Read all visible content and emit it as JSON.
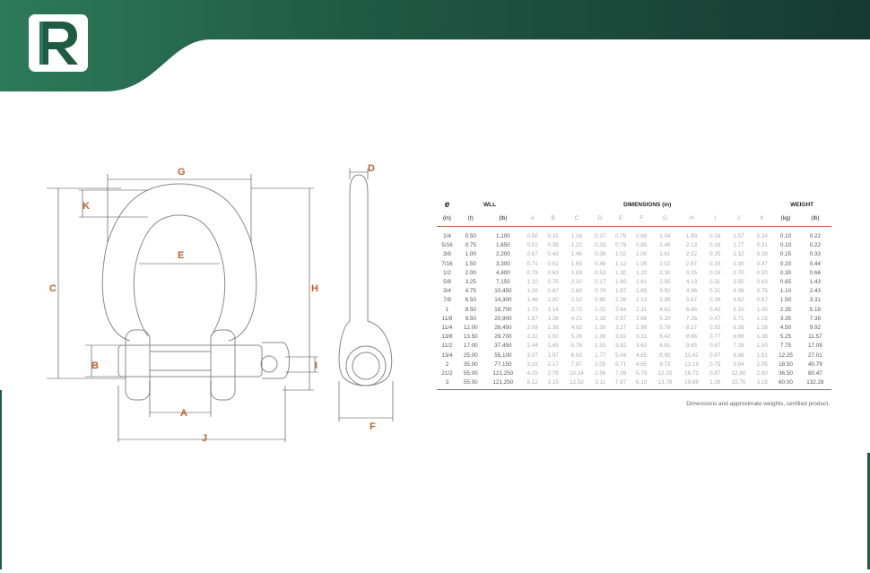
{
  "brand": {
    "logo_letter": "R",
    "primary_color": "#1f5a45",
    "accent_color": "#c0622a"
  },
  "dimension_labels": [
    "G",
    "K",
    "E",
    "C",
    "H",
    "D",
    "B",
    "A",
    "I",
    "J",
    "F"
  ],
  "table": {
    "symbol": "e",
    "group_headers": {
      "wll": "WLL",
      "dimensions": "DIMENSIONS (in)",
      "weight": "WEIGHT"
    },
    "columns": [
      "(in)",
      "(t)",
      "(lb)",
      "A",
      "B",
      "C",
      "D",
      "E",
      "F",
      "G",
      "H",
      "I",
      "J",
      "K",
      "(kg)",
      "(lb)"
    ],
    "rows": [
      [
        "1/4",
        "0.50",
        "1,100",
        "0.50",
        "0.31",
        "1.16",
        "0.27",
        "0.78",
        "0.68",
        "1.34",
        "1.89",
        "0.18",
        "1.57",
        "0.24",
        "0.10",
        "0.22"
      ],
      [
        "5/16",
        "0.75",
        "1,650",
        "0.51",
        "0.39",
        "1.22",
        "0.33",
        "0.79",
        "0.85",
        "1.48",
        "2.13",
        "0.16",
        "1.77",
        "0.31",
        "0.10",
        "0.22"
      ],
      [
        "3/8",
        "1.00",
        "2,200",
        "0.67",
        "0.43",
        "1.46",
        "0.39",
        "1.02",
        "1.00",
        "1.81",
        "2.52",
        "0.25",
        "2.12",
        "0.39",
        "0.15",
        "0.33"
      ],
      [
        "7/16",
        "1.50",
        "3,300",
        "0.71",
        "0.51",
        "1.65",
        "0.46",
        "1.12",
        "1.05",
        "2.02",
        "2.87",
        "0.20",
        "2.30",
        "0.47",
        "0.20",
        "0.44"
      ],
      [
        "1/2",
        "2.00",
        "4,400",
        "0.79",
        "0.63",
        "1.89",
        "0.53",
        "1.30",
        "1.20",
        "2.30",
        "3.25",
        "0.24",
        "2.70",
        "0.50",
        "0.30",
        "0.66"
      ],
      [
        "5/8",
        "3.25",
        "7,150",
        "1.10",
        "0.75",
        "2.32",
        "0.17",
        "1.60",
        "1.61",
        "2.95",
        "4.13",
        "0.31",
        "3.50",
        "0.63",
        "0.65",
        "1.43"
      ],
      [
        "3/4",
        "4.75",
        "10,450",
        "1.26",
        "0.87",
        "2.80",
        "0.79",
        "1.97",
        "1.89",
        "3.50",
        "4.96",
        "0.31",
        "4.06",
        "0.75",
        "1.10",
        "2.43"
      ],
      [
        "7/8",
        "6.50",
        "14,300",
        "1.46",
        "1.00",
        "2.52",
        "0.90",
        "2.26",
        "2.13",
        "3.98",
        "5.67",
        "0.39",
        "4.62",
        "0.87",
        "1.50",
        "3.31"
      ],
      [
        "1",
        "8.50",
        "18,700",
        "1.73",
        "1.14",
        "3.70",
        "1.02",
        "2.64",
        "2.31",
        "4.62",
        "6.46",
        "0.40",
        "5.10",
        "1.00",
        "2.35",
        "5.18"
      ],
      [
        "11/8",
        "9.50",
        "20,900",
        "1.87",
        "1.26",
        "4.21",
        "1.18",
        "2.87",
        "2.68",
        "5.20",
        "7.26",
        "0.47",
        "5.71",
        "1.18",
        "3.35",
        "7.39"
      ],
      [
        "11/4",
        "12.00",
        "26,450",
        "2.09",
        "1.38",
        "4.65",
        "1.30",
        "3.27",
        "2.99",
        "5.79",
        "8.27",
        "0.55",
        "6.38",
        "1.26",
        "4.50",
        "9.92"
      ],
      [
        "13/8",
        "13.50",
        "29,700",
        "2.32",
        "1.50",
        "5.26",
        "1.36",
        "3.62",
        "3.31",
        "6.42",
        "8.66",
        "0.77",
        "8.66",
        "1.38",
        "5.25",
        "11.57"
      ],
      [
        "11/2",
        "17.00",
        "37,450",
        "2.44",
        "1.65",
        "5.78",
        "1.53",
        "3.82",
        "3.62",
        "6.81",
        "9.65",
        "0.67",
        "7.28",
        "1.50",
        "7.75",
        "17.09"
      ],
      [
        "13/4",
        "25.00",
        "55,100",
        "3.07",
        "1.97",
        "6.93",
        "1.77",
        "5.04",
        "4.65",
        "8.90",
        "11.42",
        "0.67",
        "8.86",
        "1.81",
        "12.25",
        "27.01"
      ],
      [
        "2",
        "35.00",
        "77,150",
        "3.31",
        "2.17",
        "7.87",
        "2.05",
        "5.71",
        "4.65",
        "9.72",
        "13.19",
        "0.75",
        "9.84",
        "2.05",
        "18.50",
        "40.79"
      ],
      [
        "21/2",
        "55.00",
        "121,250",
        "4.25",
        "2.76",
        "10.24",
        "2.56",
        "7.09",
        "5.79",
        "12.20",
        "16.73",
        "0.87",
        "12.60",
        "2.60",
        "36.50",
        "80.47"
      ],
      [
        "3",
        "55.00",
        "121,250",
        "5.12",
        "3.15",
        "12.52",
        "3.11",
        "7.87",
        "6.10",
        "13.78",
        "19.88",
        "1.26",
        "15.75",
        "3.15",
        "60.00",
        "132.28"
      ]
    ]
  },
  "note": "Dimensions and approximate weights, certified product."
}
